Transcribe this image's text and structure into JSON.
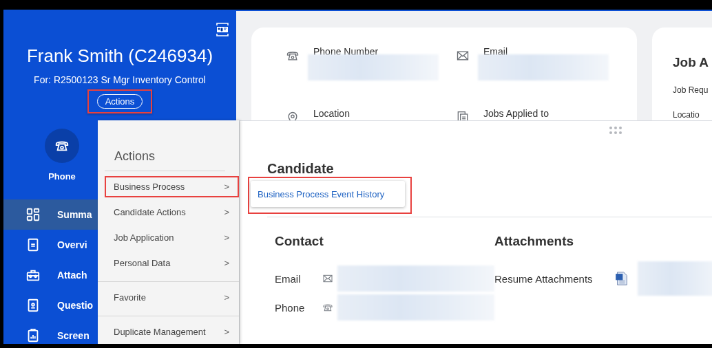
{
  "header": {
    "name": "Frank Smith (C246934)",
    "subtitle": "For: R2500123 Sr Mgr Inventory Control",
    "actions_button": {
      "label": "Actions",
      "highlighted": true
    }
  },
  "quick_actions": [
    {
      "label": "Phone"
    }
  ],
  "nav": [
    {
      "label": "Summa",
      "selected": true
    },
    {
      "label": "Overvi",
      "selected": false
    },
    {
      "label": "Attach",
      "selected": false
    },
    {
      "label": "Questio",
      "selected": false
    },
    {
      "label": "Screen",
      "selected": false
    }
  ],
  "actions_menu": {
    "title": "Actions",
    "groups": [
      {
        "items": [
          {
            "label": "Business Process",
            "chevron": ">",
            "highlighted": true
          },
          {
            "label": "Candidate Actions",
            "chevron": ">",
            "highlighted": false
          },
          {
            "label": "Job Application",
            "chevron": ">",
            "highlighted": false
          },
          {
            "label": "Personal Data",
            "chevron": ">",
            "highlighted": false
          }
        ]
      },
      {
        "items": [
          {
            "label": "Favorite",
            "chevron": ">",
            "highlighted": false
          }
        ]
      },
      {
        "items": [
          {
            "label": "Duplicate Management",
            "chevron": ">",
            "highlighted": false
          }
        ]
      }
    ]
  },
  "summary_card": {
    "fields": [
      {
        "label": "Phone Number",
        "value_redacted": true
      },
      {
        "label": "Email",
        "value_redacted": true
      },
      {
        "label": "Location",
        "value_redacted": false
      },
      {
        "label": "Jobs Applied to",
        "value_redacted": false
      }
    ]
  },
  "job_card": {
    "title": "Job A",
    "lines": [
      "Job Requ",
      "Locatio"
    ]
  },
  "candidate_panel": {
    "title": "Candidate",
    "submenu": {
      "items": [
        {
          "label": "Business Process Event History",
          "highlighted": true
        }
      ]
    },
    "contact": {
      "title": "Contact",
      "rows": [
        {
          "label": "Email",
          "value_redacted": true
        },
        {
          "label": "Phone",
          "value_redacted": true
        }
      ]
    },
    "attachments": {
      "title": "Attachments",
      "rows": [
        {
          "label": "Resume Attachments",
          "value_redacted": true
        }
      ]
    }
  }
}
